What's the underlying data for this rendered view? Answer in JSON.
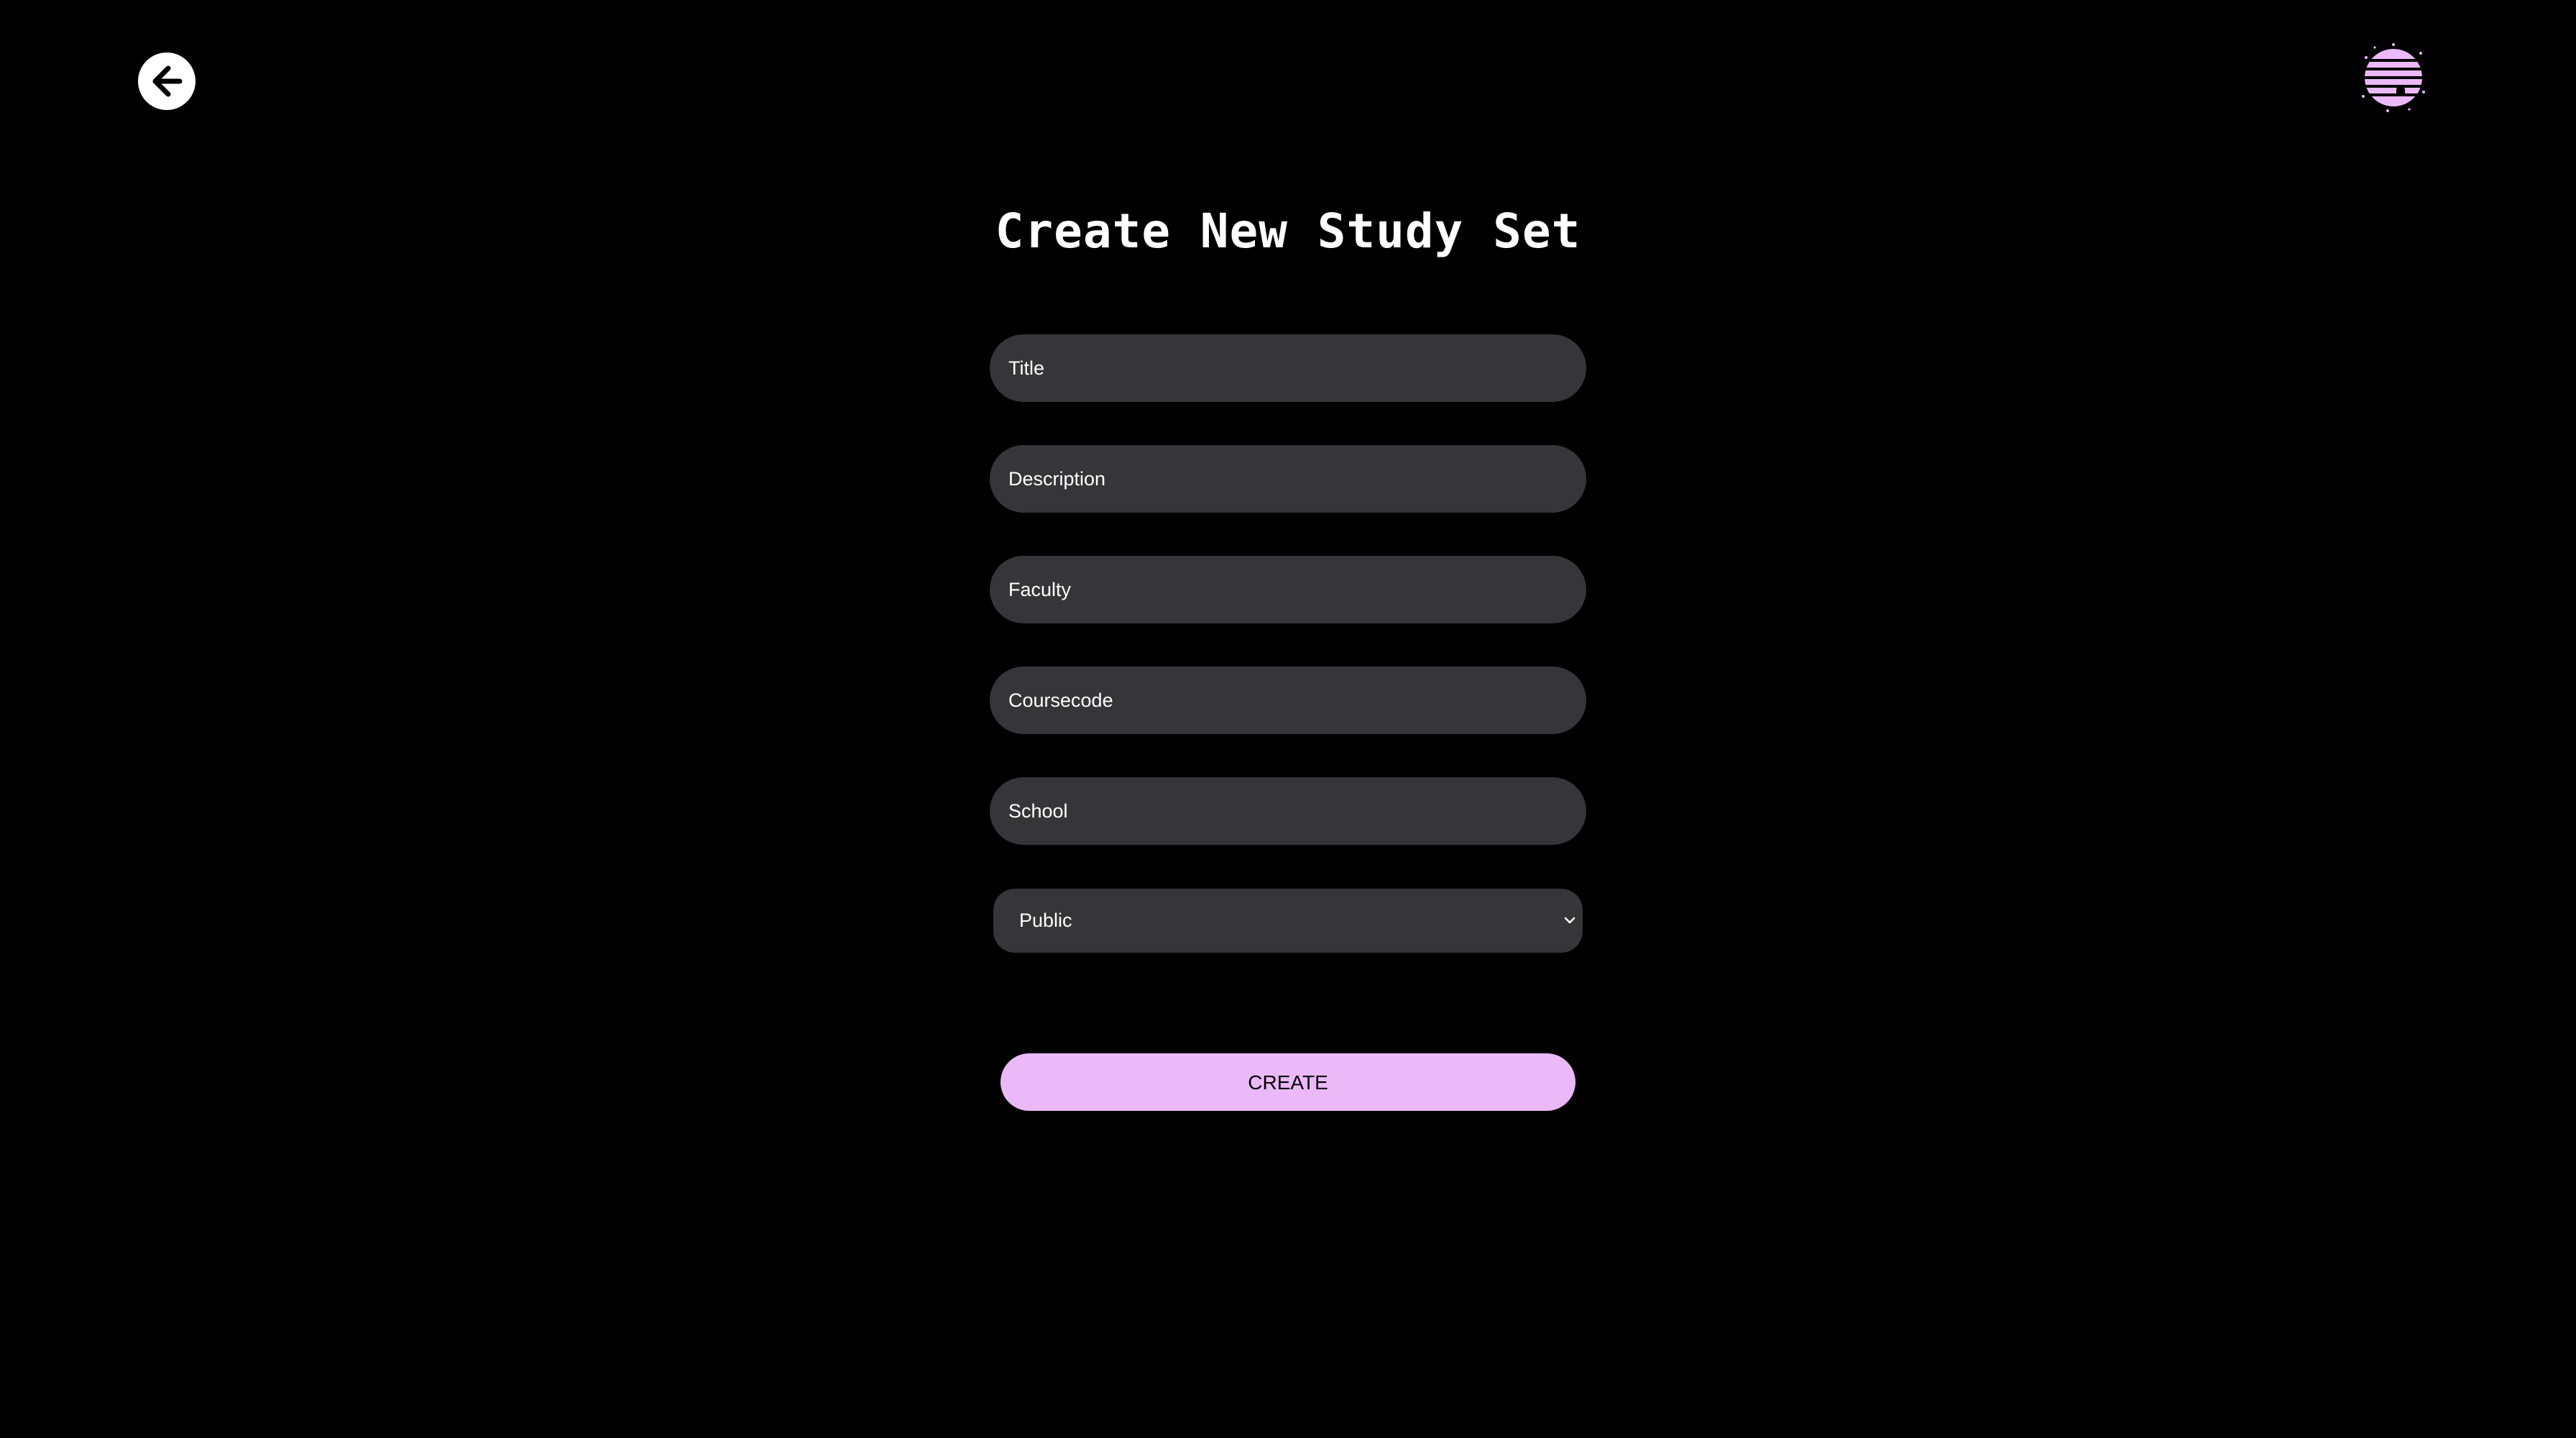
{
  "header": {
    "back_icon": "arrow-left-icon",
    "logo_icon": "striped-planet-logo"
  },
  "page_title": "Create New Study Set",
  "form": {
    "fields": [
      {
        "name": "title",
        "placeholder": "Title",
        "value": ""
      },
      {
        "name": "description",
        "placeholder": "Description",
        "value": ""
      },
      {
        "name": "faculty",
        "placeholder": "Faculty",
        "value": ""
      },
      {
        "name": "coursecode",
        "placeholder": "Coursecode",
        "value": ""
      },
      {
        "name": "school",
        "placeholder": "School",
        "value": ""
      }
    ],
    "visibility": {
      "selected": "Public",
      "icon": "chevron-down-icon"
    },
    "submit_label": "CREATE"
  },
  "colors": {
    "background": "#000000",
    "field_background": "#363638",
    "accent": "#ebb8f8",
    "text": "#ffffff"
  }
}
